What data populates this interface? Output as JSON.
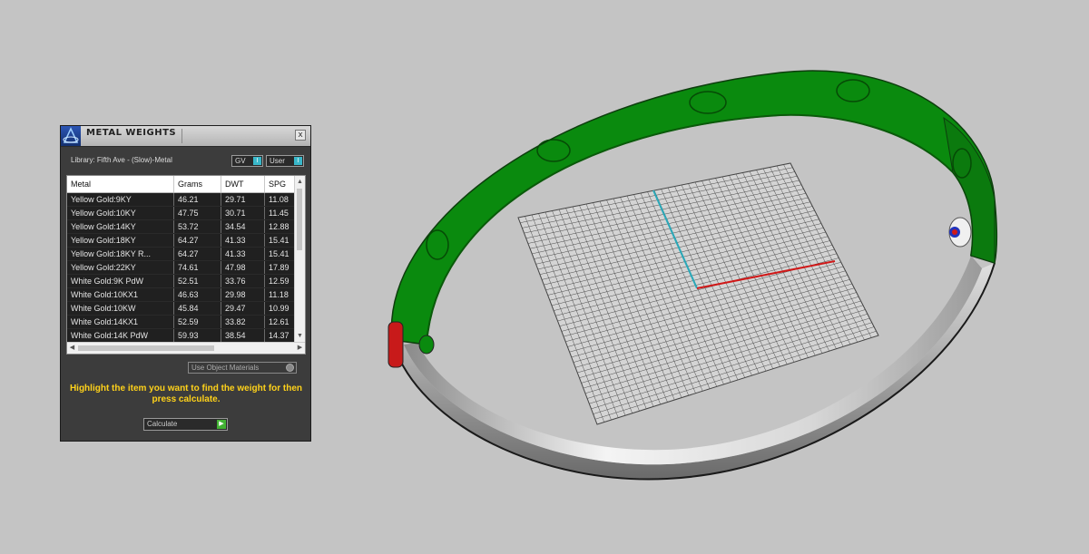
{
  "panel": {
    "title": "METAL WEIGHTS",
    "close_label": "x",
    "library_label": "Library: Fifth Ave - (Slow)-Metal",
    "toggle_gv_label": "GV",
    "toggle_user_label": "User",
    "toggle_indicator": "I",
    "columns": [
      "Metal",
      "Grams",
      "DWT",
      "SPG"
    ],
    "rows": [
      [
        "Yellow Gold:9KY",
        "46.21",
        "29.71",
        "11.08"
      ],
      [
        "Yellow Gold:10KY",
        "47.75",
        "30.71",
        "11.45"
      ],
      [
        "Yellow Gold:14KY",
        "53.72",
        "34.54",
        "12.88"
      ],
      [
        "Yellow Gold:18KY",
        "64.27",
        "41.33",
        "15.41"
      ],
      [
        "Yellow Gold:18KY R...",
        "64.27",
        "41.33",
        "15.41"
      ],
      [
        "Yellow Gold:22KY",
        "74.61",
        "47.98",
        "17.89"
      ],
      [
        "White Gold:9K PdW",
        "52.51",
        "33.76",
        "12.59"
      ],
      [
        "White Gold:10KX1",
        "46.63",
        "29.98",
        "11.18"
      ],
      [
        "White Gold:10KW",
        "45.84",
        "29.47",
        "10.99"
      ],
      [
        "White Gold:14KX1",
        "52.59",
        "33.82",
        "12.61"
      ],
      [
        "White Gold:14K PdW",
        "59.93",
        "38.54",
        "14.37"
      ]
    ],
    "use_object_materials_label": "Use Object Materials",
    "instructions": "Highlight the item you want to find the weight for then press calculate.",
    "calculate_label": "Calculate",
    "go_glyph": "▶"
  },
  "colors": {
    "viewport_bg": "#c4c4c4",
    "ring_green": "#0a8a0e",
    "ring_metal": "#e8e8e8",
    "grid_line": "#3a3a3a",
    "x_axis": "#d01818",
    "y_axis": "#2aa8b8",
    "instruction_text": "#ffd21a"
  }
}
